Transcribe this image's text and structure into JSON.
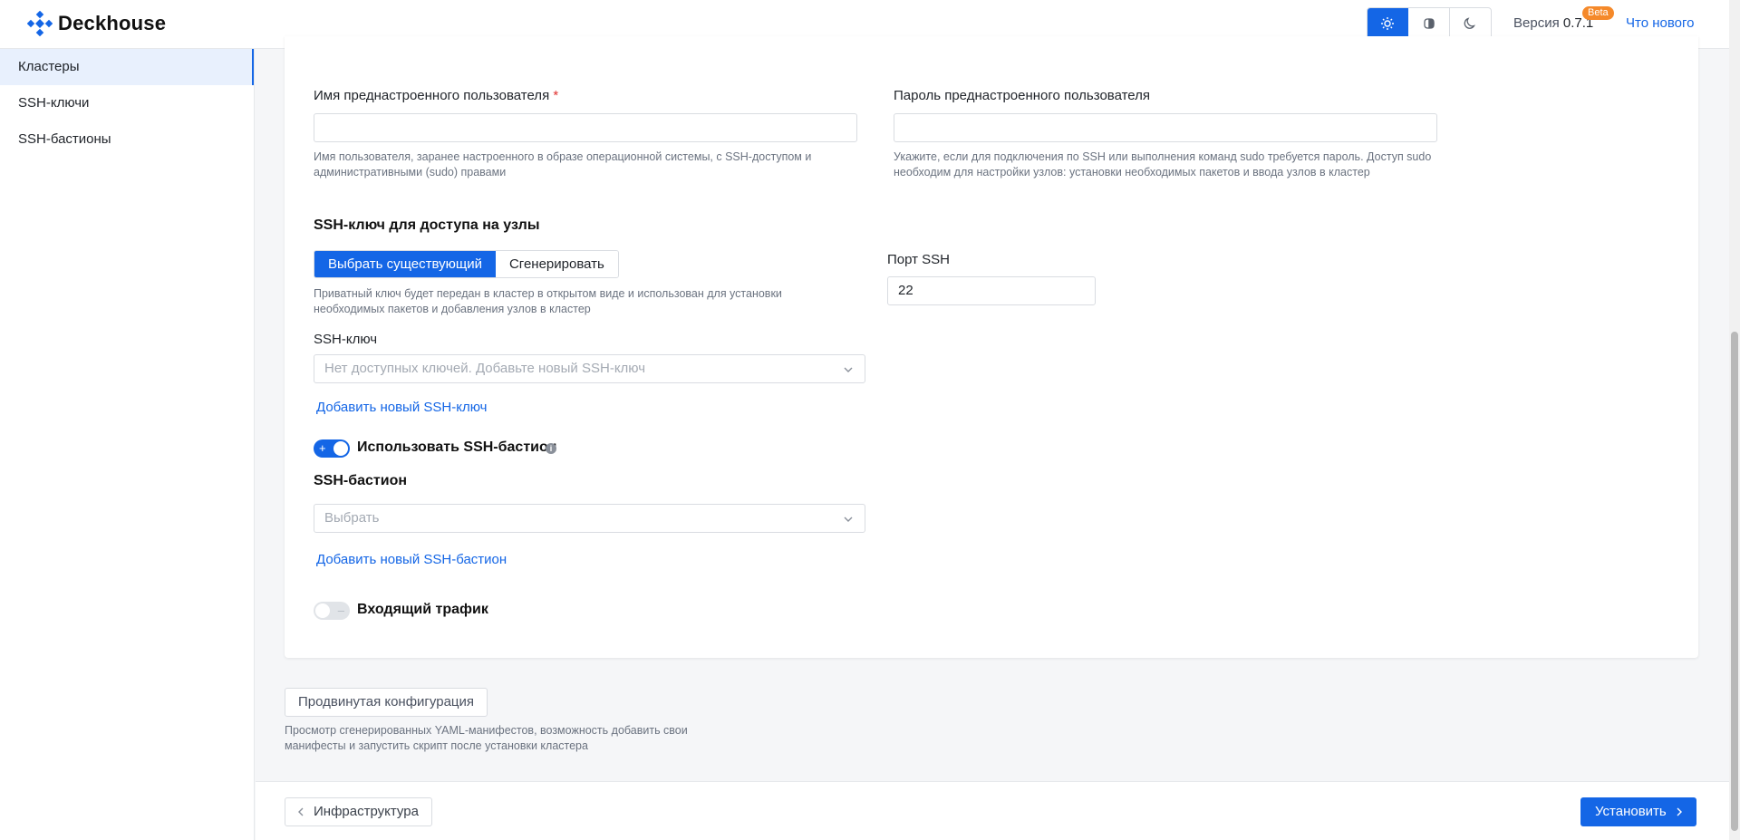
{
  "app": {
    "name": "Deckhouse"
  },
  "header": {
    "theme_buttons": [
      {
        "name": "light",
        "icon": "sun-icon",
        "active": true
      },
      {
        "name": "system",
        "icon": "contrast-icon",
        "active": false
      },
      {
        "name": "dark",
        "icon": "moon-icon",
        "active": false
      }
    ],
    "version_label": "Версия",
    "version_number": "0.7.1",
    "beta_badge": "Beta",
    "whats_new": "Что нового"
  },
  "sidebar": {
    "items": [
      {
        "label": "Кластеры",
        "active": true
      },
      {
        "label": "SSH-ключи",
        "active": false
      },
      {
        "label": "SSH-бастионы",
        "active": false
      }
    ]
  },
  "form": {
    "preset_user": {
      "label": "Имя преднастроенного пользователя",
      "required_mark": "*",
      "value": "",
      "help": "Имя пользователя, заранее настроенного в образе операционной системы, с SSH-доступом и административными (sudo) правами"
    },
    "preset_password": {
      "label": "Пароль преднастроенного пользователя",
      "value": "",
      "help": "Укажите, если для подключения по SSH или выполнения команд sudo требуется пароль. Доступ sudo необходим для настройки узлов: установки необходимых пакетов и ввода узлов в кластер"
    },
    "ssh_key_section": {
      "title": "SSH-ключ для доступа на узлы",
      "mode_options": [
        "Выбрать существующий",
        "Сгенерировать"
      ],
      "mode_selected": "Выбрать существующий",
      "help": "Приватный ключ будет передан в кластер в открытом виде и использован для установки необходимых пакетов и добавления узлов в кластер",
      "key_label": "SSH-ключ",
      "key_placeholder": "Нет доступных ключей. Добавьте новый SSH-ключ",
      "add_key_link": "Добавить новый SSH-ключ"
    },
    "ssh_port": {
      "label": "Порт SSH",
      "value": "22"
    },
    "bastion": {
      "toggle_label": "Использовать SSH-бастион",
      "toggle_on": true,
      "toggle_on_mark": "+",
      "info_icon": "info-icon",
      "title": "SSH-бастион",
      "placeholder": "Выбрать",
      "add_link": "Добавить новый SSH-бастион"
    },
    "ingress": {
      "toggle_label": "Входящий трафик",
      "toggle_on": false,
      "toggle_off_mark": "–"
    }
  },
  "advanced": {
    "button": "Продвинутая конфигурация",
    "help": "Просмотр сгенерированных YAML-манифестов, возможность добавить свои манифесты и запустить скрипт после установки кластера"
  },
  "footer": {
    "back_button": "Инфраструктура",
    "install_button": "Установить"
  },
  "colors": {
    "accent": "#1466e6",
    "beta": "#f5892a",
    "required": "#e0312f"
  }
}
